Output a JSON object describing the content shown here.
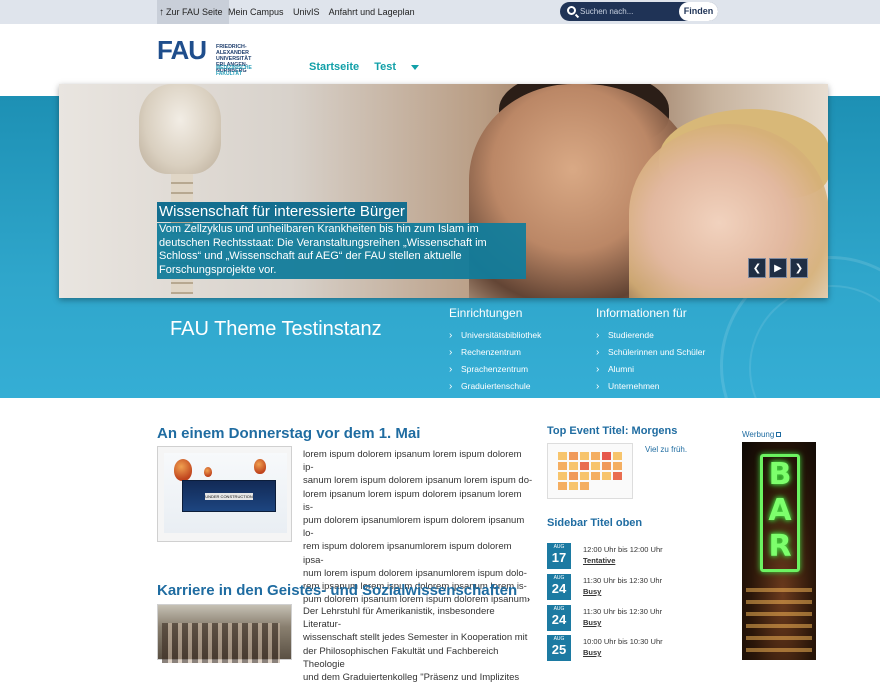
{
  "topbar": {
    "home_label": "Zur FAU Seite",
    "links": [
      "Mein Campus",
      "UnivIS",
      "Anfahrt und Lageplan"
    ],
    "search_placeholder": "Suchen nach...",
    "search_button": "Finden"
  },
  "header": {
    "logo_text": "FAU",
    "logo_lines": [
      "FRIEDRICH-ALEXANDER",
      "UNIVERSITÄT",
      "ERLANGEN-NÜRNBERG"
    ],
    "faculty": "MEDIZINISCHE FAKULTÄT",
    "nav": [
      "Startseite",
      "Test"
    ]
  },
  "slider": {
    "caption_title": "Wissenschaft für interessierte Bürger",
    "caption_text": "Vom Zellzyklus und unheilbaren Krankheiten bis hin zum Islam im deutschen Rechtsstaat: Die Veranstaltungsreihen „Wissenschaft im Schloss“ und „Wissenschaft auf AEG“ der FAU stellen aktuelle Forschungsprojekte vor.",
    "controls": [
      "❮",
      "▶",
      "❯"
    ]
  },
  "band": {
    "site_title": "FAU Theme Testinstanz",
    "col1": {
      "title": "Einrichtungen",
      "items": [
        "Universitätsbibliothek",
        "Rechenzentrum",
        "Sprachenzentrum",
        "Graduiertenschule"
      ]
    },
    "col2": {
      "title": "Informationen für",
      "items": [
        "Studierende",
        "Schülerinnen und Schüler",
        "Alumni",
        "Unternehmen"
      ]
    }
  },
  "articles": [
    {
      "title": "An einem Donnerstag vor dem 1. Mai",
      "thumb_text": "UNDER CONSTRUCTION",
      "lines": [
        "lorem ispum dolorem ipsanum lorem ispum dolorem ip-",
        "sanum lorem ispum dolorem ipsanum lorem ispum do-",
        "lorem ipsanum lorem ispum dolorem ipsanum lorem is-",
        "pum dolorem ipsanumlorem ispum dolorem ipsanum lo-",
        "rem ispum dolorem ipsanumlorem ispum dolorem ipsa-",
        "num lorem ispum dolorem ipsanumlorem ispum dolo-",
        "rem ipsanum lorem ispum dolorem ipsanum lorem is-",
        "pum dolorem ipsanum lorem ispum dolorem ipsanum"
      ],
      "more_icon": "›"
    },
    {
      "title": "Karriere in den Geistes- und Sozialwissenschaften",
      "lines": [
        "Der Lehrstuhl für Amerikanistik, insbesondere Literatur-",
        "wissenschaft stellt jedes Semester in Kooperation mit",
        "der Philosophischen Fakultät und Fachbereich Theologie",
        "und dem Graduiertenkolleg \"Präsenz und Implizites"
      ]
    }
  ],
  "sidebar": {
    "top_event_title": "Top Event Titel: Morgens",
    "top_event_link": "Viel zu früh.",
    "list_title": "Sidebar Titel oben",
    "events": [
      {
        "mon": "AUG",
        "day": "17",
        "time": "12:00 Uhr bis 12:00 Uhr",
        "status": "Tentative"
      },
      {
        "mon": "AUG",
        "day": "24",
        "time": "11:30 Uhr bis 12:30 Uhr",
        "status": "Busy"
      },
      {
        "mon": "AUG",
        "day": "24",
        "time": "11:30 Uhr bis 12:30 Uhr",
        "status": "Busy"
      },
      {
        "mon": "AUG",
        "day": "25",
        "time": "10:00 Uhr bis 10:30 Uhr",
        "status": "Busy"
      }
    ]
  },
  "ad": {
    "label": "Werbung",
    "sign_letters": [
      "B",
      "A",
      "R"
    ]
  },
  "colors": {
    "brand_blue": "#1f4e8c",
    "accent_teal": "#11a0a8",
    "band_blue": "#2fa6cb",
    "link_blue": "#1f6ca1"
  }
}
